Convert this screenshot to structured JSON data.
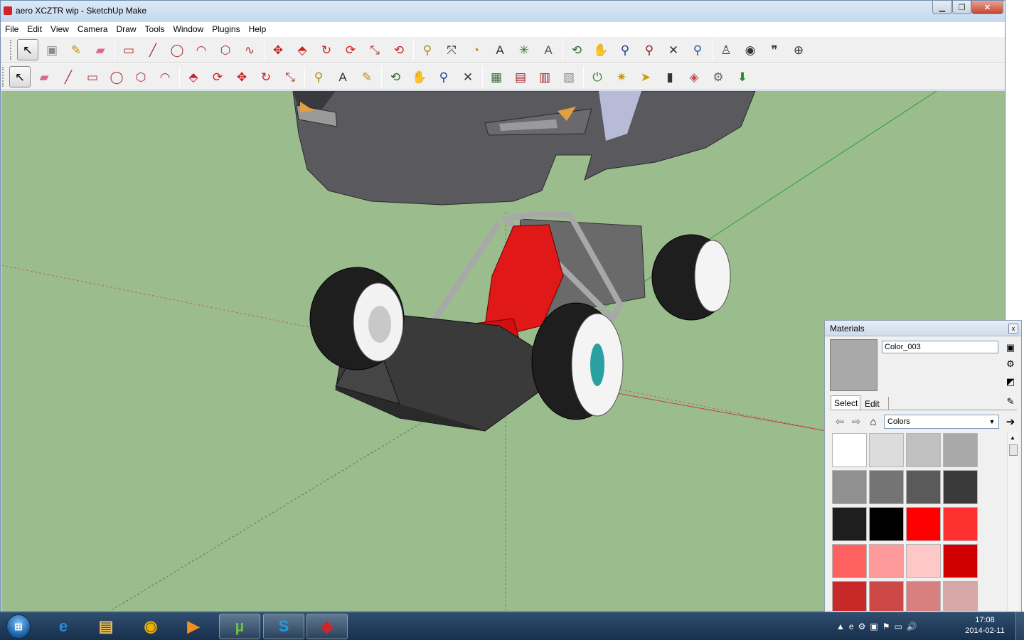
{
  "window": {
    "title": "aero XCZTR wip - SketchUp Make",
    "minimize_label": "▁",
    "maximize_label": "❐",
    "close_label": "✕"
  },
  "menu": [
    "File",
    "Edit",
    "View",
    "Camera",
    "Draw",
    "Tools",
    "Window",
    "Plugins",
    "Help"
  ],
  "toolbar1": [
    {
      "name": "select-tool",
      "icon": "↖",
      "color": "#000000",
      "active": true
    },
    {
      "name": "make-component-tool",
      "icon": "▣",
      "color": "#8a8a8a"
    },
    {
      "name": "paint-bucket-tool",
      "icon": "✎",
      "color": "#c58a17"
    },
    {
      "name": "eraser-tool",
      "icon": "▰",
      "color": "#d86a8a"
    },
    {
      "name": "rectangle-tool",
      "icon": "▭",
      "color": "#b03030"
    },
    {
      "name": "line-tool",
      "icon": "╱",
      "color": "#b03030"
    },
    {
      "name": "circle-tool",
      "icon": "◯",
      "color": "#b03030"
    },
    {
      "name": "arc-tool",
      "icon": "◠",
      "color": "#b03030"
    },
    {
      "name": "polygon-tool",
      "icon": "⬡",
      "color": "#b03030"
    },
    {
      "name": "freehand-tool",
      "icon": "∿",
      "color": "#b03030"
    },
    {
      "name": "move-tool",
      "icon": "✥",
      "color": "#cc2020"
    },
    {
      "name": "push-pull-tool",
      "icon": "⬘",
      "color": "#cc2020"
    },
    {
      "name": "rotate-tool",
      "icon": "↻",
      "color": "#cc2020"
    },
    {
      "name": "follow-me-tool",
      "icon": "⟳",
      "color": "#cc2020"
    },
    {
      "name": "scale-tool",
      "icon": "⤡",
      "color": "#cc2020"
    },
    {
      "name": "offset-tool",
      "icon": "⟲",
      "color": "#cc2020"
    },
    {
      "name": "tape-measure-tool",
      "icon": "⚲",
      "color": "#b08a10"
    },
    {
      "name": "dimension-tool",
      "icon": "⤧",
      "color": "#333333"
    },
    {
      "name": "protractor-tool",
      "icon": "◔",
      "color": "#b08a10"
    },
    {
      "name": "text-tool",
      "icon": "A",
      "color": "#333333"
    },
    {
      "name": "axes-tool",
      "icon": "✳",
      "color": "#2a7a2a"
    },
    {
      "name": "3d-text-tool",
      "icon": "A",
      "color": "#555555"
    },
    {
      "name": "orbit-tool",
      "icon": "⟲",
      "color": "#2a6a2a"
    },
    {
      "name": "pan-tool",
      "icon": "✋",
      "color": "#333333"
    },
    {
      "name": "zoom-tool",
      "icon": "⚲",
      "color": "#1a3a8a"
    },
    {
      "name": "zoom-window-tool",
      "icon": "⚲",
      "color": "#8a1a1a"
    },
    {
      "name": "zoom-extents-tool",
      "icon": "✕",
      "color": "#333333"
    },
    {
      "name": "previous-view-tool",
      "icon": "⚲",
      "color": "#1a5a9a"
    },
    {
      "name": "position-camera-tool",
      "icon": "♙",
      "color": "#333333"
    },
    {
      "name": "look-around-tool",
      "icon": "◉",
      "color": "#333333"
    },
    {
      "name": "walk-tool",
      "icon": "❞",
      "color": "#333333"
    },
    {
      "name": "section-plane-tool",
      "icon": "⊕",
      "color": "#333333"
    }
  ],
  "toolbar2": [
    {
      "name": "select-tool-2",
      "icon": "↖",
      "color": "#000000",
      "active": true
    },
    {
      "name": "eraser-tool-2",
      "icon": "▰",
      "color": "#d86a8a"
    },
    {
      "name": "line-tool-2",
      "icon": "╱",
      "color": "#b03030"
    },
    {
      "name": "rectangle-tool-2",
      "icon": "▭",
      "color": "#b03030"
    },
    {
      "name": "circle-tool-2",
      "icon": "◯",
      "color": "#b03030"
    },
    {
      "name": "polygon-tool-2",
      "icon": "⬡",
      "color": "#b03030"
    },
    {
      "name": "arc-tool-2",
      "icon": "◠",
      "color": "#b03030"
    },
    {
      "name": "push-pull-tool-2",
      "icon": "⬘",
      "color": "#cc2020"
    },
    {
      "name": "follow-me-tool-2",
      "icon": "⟳",
      "color": "#cc2020"
    },
    {
      "name": "move-tool-2",
      "icon": "✥",
      "color": "#cc2020"
    },
    {
      "name": "rotate-tool-2",
      "icon": "↻",
      "color": "#cc2020"
    },
    {
      "name": "scale-tool-2",
      "icon": "⤡",
      "color": "#cc2020"
    },
    {
      "name": "tape-measure-tool-2",
      "icon": "⚲",
      "color": "#b08a10"
    },
    {
      "name": "text-tool-2",
      "icon": "A",
      "color": "#333333"
    },
    {
      "name": "paint-bucket-tool-2",
      "icon": "✎",
      "color": "#c58a17"
    },
    {
      "name": "orbit-tool-2",
      "icon": "⟲",
      "color": "#2a6a2a"
    },
    {
      "name": "pan-tool-2",
      "icon": "✋",
      "color": "#333333"
    },
    {
      "name": "zoom-tool-2",
      "icon": "⚲",
      "color": "#1a3a8a"
    },
    {
      "name": "zoom-extents-tool-2",
      "icon": "✕",
      "color": "#333333"
    },
    {
      "name": "warehouse-tool",
      "icon": "▦",
      "color": "#3a6a3a"
    },
    {
      "name": "share-model-tool",
      "icon": "▤",
      "color": "#a02020"
    },
    {
      "name": "get-models-tool",
      "icon": "▥",
      "color": "#a02020"
    },
    {
      "name": "extension-tool",
      "icon": "▧",
      "color": "#8a8a8a"
    },
    {
      "name": "plugin-power-tool",
      "icon": "⏻",
      "color": "#2a8a2a"
    },
    {
      "name": "plugin-sparkle-tool",
      "icon": "✷",
      "color": "#c8a000"
    },
    {
      "name": "plugin-cursor-tool",
      "icon": "➤",
      "color": "#c8a000"
    },
    {
      "name": "plugin-film-tool",
      "icon": "▮",
      "color": "#333333"
    },
    {
      "name": "plugin-palette-tool",
      "icon": "◈",
      "color": "#c05050"
    },
    {
      "name": "plugin-settings-tool",
      "icon": "⚙",
      "color": "#666666"
    },
    {
      "name": "plugin-export-tool",
      "icon": "⬇",
      "color": "#2a8a2a"
    }
  ],
  "materials": {
    "title": "Materials",
    "close_label": "x",
    "material_name": "Color_003",
    "swatch_color": "#a9a9a9",
    "tabs": [
      "Select",
      "Edit"
    ],
    "library": "Colors",
    "swatches": [
      "#ffffff",
      "#dcdcdc",
      "#c0c0c0",
      "#a9a9a9",
      "#909090",
      "#747474",
      "#5a5a5a",
      "#3a3a3a",
      "#1e1e1e",
      "#000000",
      "#ff0000",
      "#ff3030",
      "#ff6060",
      "#ff9a9a",
      "#ffc8c8",
      "#d00000",
      "#c82828",
      "#cc4848",
      "#d88080",
      "#d8a8a8"
    ]
  },
  "taskbar": {
    "start_label": "⊞",
    "items": [
      {
        "name": "internet-explorer-task",
        "icon": "e",
        "color": "#2a8ad8"
      },
      {
        "name": "file-explorer-task",
        "icon": "▤",
        "color": "#e8c060"
      },
      {
        "name": "chrome-task",
        "icon": "◉",
        "color": "#e8b000"
      },
      {
        "name": "media-player-task",
        "icon": "▶",
        "color": "#f09020"
      },
      {
        "name": "utorrent-task",
        "icon": "µ",
        "color": "#6ec040"
      },
      {
        "name": "skype-task",
        "icon": "S",
        "color": "#1aa0e0"
      },
      {
        "name": "sketchup-task",
        "icon": "◆",
        "color": "#d0252a"
      }
    ],
    "tray_icons": [
      "▲",
      "e",
      "⚙",
      "▣",
      "⚑",
      "▭",
      "🔊"
    ],
    "time": "17:08",
    "date": "2014-02-11"
  }
}
